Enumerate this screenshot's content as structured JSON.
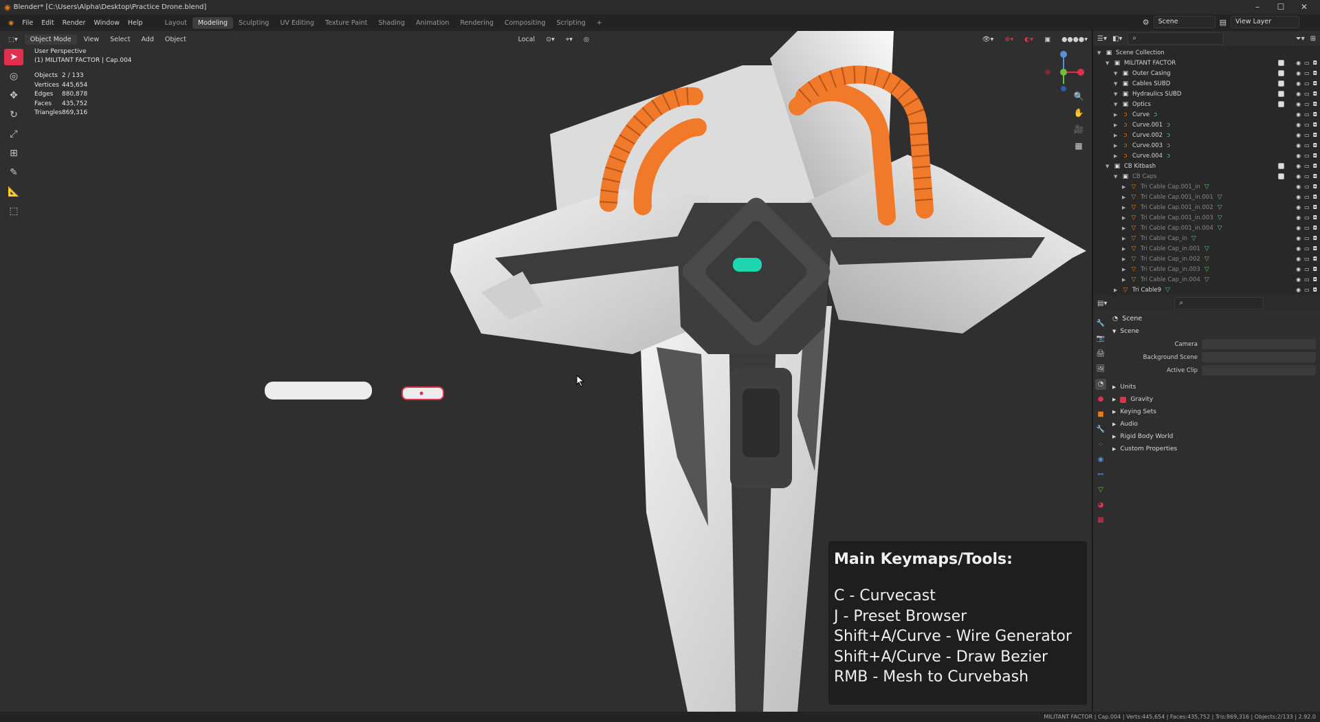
{
  "titlebar": {
    "title": "Blender* [C:\\Users\\Alpha\\Desktop\\Practice Drone.blend]",
    "minimize": "–",
    "maximize": "☐",
    "close": "✕"
  },
  "menu": {
    "items": [
      "File",
      "Edit",
      "Render",
      "Window",
      "Help"
    ]
  },
  "workspaces": {
    "tabs": [
      "Layout",
      "Modeling",
      "Sculpting",
      "UV Editing",
      "Texture Paint",
      "Shading",
      "Animation",
      "Rendering",
      "Compositing",
      "Scripting"
    ],
    "active": "Modeling",
    "add": "+"
  },
  "scene_selector": {
    "value": "Scene"
  },
  "view_layer_selector": {
    "value": "View Layer"
  },
  "viewport_header": {
    "mode": "Object Mode",
    "menus": [
      "View",
      "Select",
      "Add",
      "Object"
    ],
    "transform_orientation": "Local"
  },
  "viewport_info": {
    "perspective": "User Perspective",
    "active": "(1) MILITANT FACTOR | Cap.004"
  },
  "stats": [
    {
      "k": "Objects",
      "v": "2 / 133"
    },
    {
      "k": "Vertices",
      "v": "445,654"
    },
    {
      "k": "Edges",
      "v": "880,878"
    },
    {
      "k": "Faces",
      "v": "435,752"
    },
    {
      "k": "Triangles",
      "v": "869,316"
    }
  ],
  "overlay": {
    "title": "Main Keymaps/Tools:",
    "lines": [
      "C - Curvecast",
      "J - Preset Browser",
      "Shift+A/Curve - Wire Generator",
      "Shift+A/Curve - Draw Bezier",
      "RMB - Mesh to Curvebash"
    ]
  },
  "outliner": {
    "rows": [
      {
        "label": "Scene Collection",
        "indent": 0,
        "icon": "▣",
        "type": "coll"
      },
      {
        "label": "MILITANT FACTOR",
        "indent": 1,
        "icon": "▣",
        "type": "coll",
        "chk": true
      },
      {
        "label": "Outer Casing",
        "indent": 2,
        "icon": "▣",
        "type": "coll",
        "chk": true
      },
      {
        "label": "Cables SUBD",
        "indent": 2,
        "icon": "▣",
        "type": "coll",
        "chk": true
      },
      {
        "label": "Hydraulics SUBD",
        "indent": 2,
        "icon": "▣",
        "type": "coll",
        "chk": true
      },
      {
        "label": "Optics",
        "indent": 2,
        "icon": "▣",
        "type": "coll",
        "chk": true
      },
      {
        "label": "Curve",
        "indent": 2,
        "icon": "ↄ",
        "type": "curve"
      },
      {
        "label": "Curve.001",
        "indent": 2,
        "icon": "ↄ",
        "type": "curve"
      },
      {
        "label": "Curve.002",
        "indent": 2,
        "icon": "ↄ",
        "type": "curve"
      },
      {
        "label": "Curve.003",
        "indent": 2,
        "icon": "ↄ",
        "type": "curve"
      },
      {
        "label": "Curve.004",
        "indent": 2,
        "icon": "ↄ",
        "type": "curve"
      },
      {
        "label": "CB Kitbash",
        "indent": 1,
        "icon": "▣",
        "type": "coll",
        "chk": true
      },
      {
        "label": "CB Caps",
        "indent": 2,
        "icon": "▣",
        "type": "coll",
        "dim": true,
        "chk": true
      },
      {
        "label": "Tri Cable Cap.001_in",
        "indent": 3,
        "icon": "▽",
        "type": "mesh",
        "dim": true
      },
      {
        "label": "Tri Cable Cap.001_in.001",
        "indent": 3,
        "icon": "▽",
        "type": "mesh",
        "dim": true
      },
      {
        "label": "Tri Cable Cap.001_in.002",
        "indent": 3,
        "icon": "▽",
        "type": "mesh",
        "dim": true
      },
      {
        "label": "Tri Cable Cap.001_in.003",
        "indent": 3,
        "icon": "▽",
        "type": "mesh",
        "dim": true
      },
      {
        "label": "Tri Cable Cap.001_in.004",
        "indent": 3,
        "icon": "▽",
        "type": "mesh",
        "dim": true
      },
      {
        "label": "Tri Cable Cap_in",
        "indent": 3,
        "icon": "▽",
        "type": "mesh",
        "dim": true
      },
      {
        "label": "Tri Cable Cap_in.001",
        "indent": 3,
        "icon": "▽",
        "type": "mesh",
        "dim": true
      },
      {
        "label": "Tri Cable Cap_in.002",
        "indent": 3,
        "icon": "▽",
        "type": "mesh",
        "dim": true
      },
      {
        "label": "Tri Cable Cap_in.003",
        "indent": 3,
        "icon": "▽",
        "type": "mesh",
        "dim": true
      },
      {
        "label": "Tri Cable Cap_in.004",
        "indent": 3,
        "icon": "▽",
        "type": "mesh",
        "dim": true
      },
      {
        "label": "Tri Cable9",
        "indent": 2,
        "icon": "▽",
        "type": "mesh"
      }
    ]
  },
  "properties": {
    "title": "Scene",
    "section": "Scene",
    "fields": [
      {
        "label": "Camera",
        "value": ""
      },
      {
        "label": "Background Scene",
        "value": ""
      },
      {
        "label": "Active Clip",
        "value": ""
      }
    ],
    "subsections": [
      "Units",
      "Gravity",
      "Keying Sets",
      "Audio",
      "Rigid Body World",
      "Custom Properties"
    ]
  },
  "statusbar": {
    "text": "MILITANT FACTOR | Cap.004 | Verts:445,654 | Faces:435,752 | Tris:869,316 | Objects:2/133 | 2.92.0"
  },
  "colors": {
    "accent": "#e0304e",
    "orange": "#f07a2a",
    "teal": "#1fd6b0",
    "hull": "#e6e6e6"
  }
}
